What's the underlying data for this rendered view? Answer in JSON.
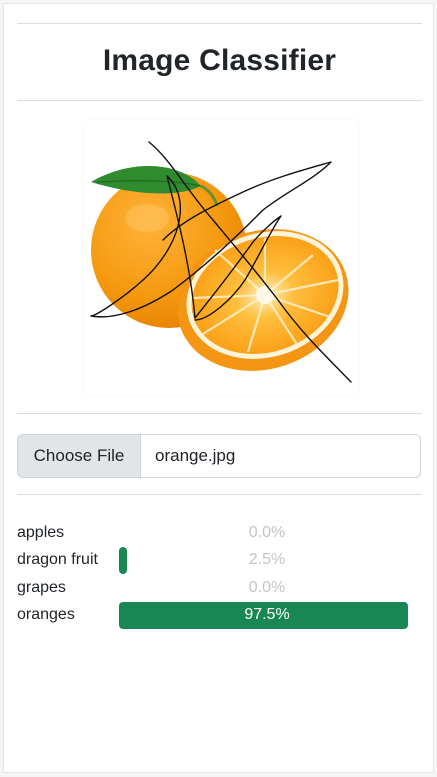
{
  "header": {
    "title": "Image Classifier"
  },
  "image": {
    "alt": "orange with hand-drawn scribble"
  },
  "file_input": {
    "button_label": "Choose File",
    "file_name": "orange.jpg"
  },
  "results": [
    {
      "label": "apples",
      "percent_text": "0.0%",
      "value": 0.0
    },
    {
      "label": "dragon fruit",
      "percent_text": "2.5%",
      "value": 2.5
    },
    {
      "label": "grapes",
      "percent_text": "0.0%",
      "value": 0.0
    },
    {
      "label": "oranges",
      "percent_text": "97.5%",
      "value": 97.5
    }
  ],
  "colors": {
    "bar": "#198754",
    "muted_text": "#c4c4c4",
    "bar_text": "#ffffff"
  }
}
